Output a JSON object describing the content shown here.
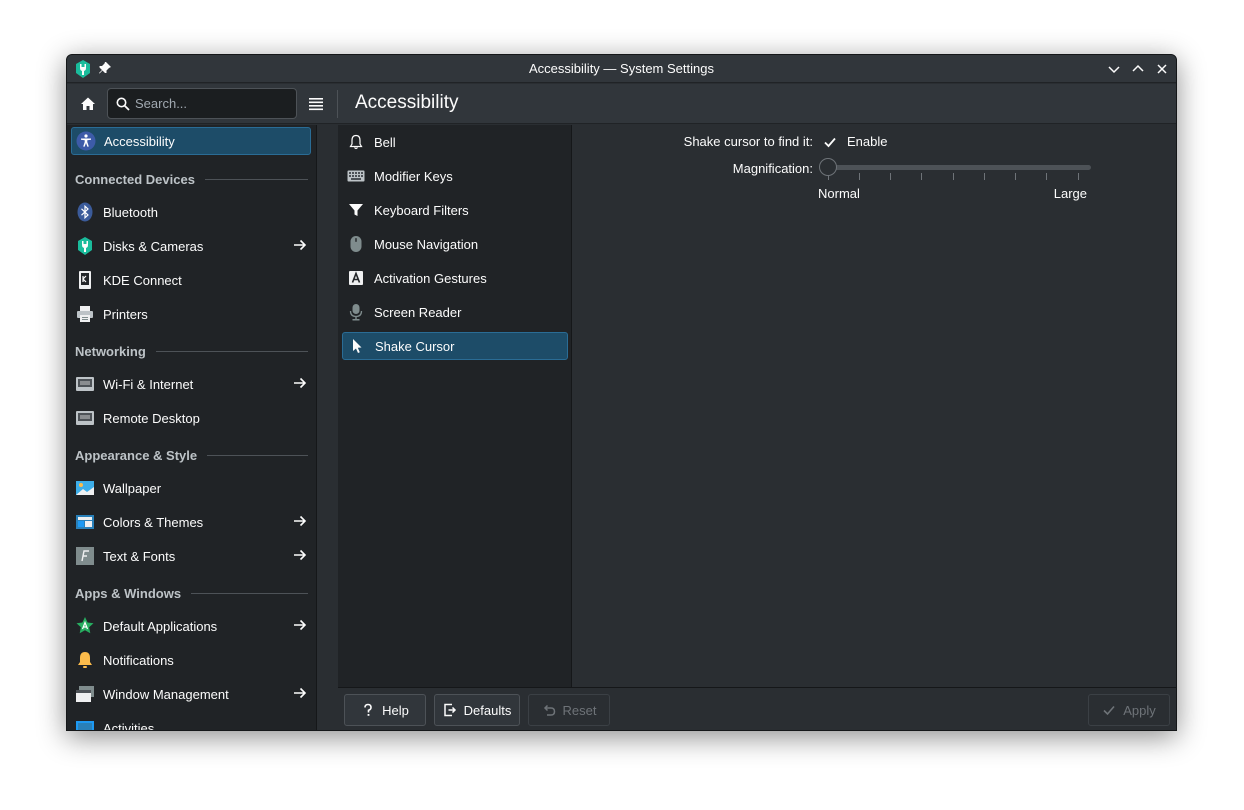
{
  "window": {
    "title": "Accessibility — System Settings"
  },
  "toolbar": {
    "search_placeholder": "Search...",
    "page_title": "Accessibility"
  },
  "sidebar": {
    "active": {
      "label": "Accessibility",
      "icon": "accessibility-icon"
    },
    "sections": [
      {
        "header": "Connected Devices",
        "items": [
          {
            "label": "Bluetooth",
            "icon": "bluetooth-icon",
            "arrow": false
          },
          {
            "label": "Disks & Cameras",
            "icon": "disks-icon",
            "arrow": true
          },
          {
            "label": "KDE Connect",
            "icon": "kde-connect-icon",
            "arrow": false
          },
          {
            "label": "Printers",
            "icon": "printer-icon",
            "arrow": false
          }
        ]
      },
      {
        "header": "Networking",
        "items": [
          {
            "label": "Wi-Fi & Internet",
            "icon": "network-icon",
            "arrow": true
          },
          {
            "label": "Remote Desktop",
            "icon": "remote-desktop-icon",
            "arrow": false
          }
        ]
      },
      {
        "header": "Appearance & Style",
        "items": [
          {
            "label": "Wallpaper",
            "icon": "wallpaper-icon",
            "arrow": false
          },
          {
            "label": "Colors & Themes",
            "icon": "colors-icon",
            "arrow": true
          },
          {
            "label": "Text & Fonts",
            "icon": "fonts-icon",
            "arrow": true
          }
        ]
      },
      {
        "header": "Apps & Windows",
        "items": [
          {
            "label": "Default Applications",
            "icon": "default-apps-icon",
            "arrow": true
          },
          {
            "label": "Notifications",
            "icon": "bell-yellow-icon",
            "arrow": false
          },
          {
            "label": "Window Management",
            "icon": "window-management-icon",
            "arrow": true
          },
          {
            "label": "Activities",
            "icon": "activities-icon",
            "arrow": false
          }
        ]
      }
    ]
  },
  "subpanel": {
    "items": [
      {
        "label": "Bell",
        "icon": "bell-icon"
      },
      {
        "label": "Modifier Keys",
        "icon": "keyboard-icon"
      },
      {
        "label": "Keyboard Filters",
        "icon": "filter-icon"
      },
      {
        "label": "Mouse Navigation",
        "icon": "mouse-icon"
      },
      {
        "label": "Activation Gestures",
        "icon": "gesture-icon"
      },
      {
        "label": "Screen Reader",
        "icon": "microphone-icon"
      },
      {
        "label": "Shake Cursor",
        "icon": "cursor-icon",
        "active": true
      }
    ]
  },
  "content": {
    "shake_label": "Shake cursor to find it:",
    "enable_label": "Enable",
    "enable_checked": true,
    "magnification_label": "Magnification:",
    "slider_min_label": "Normal",
    "slider_max_label": "Large",
    "slider_value": 0
  },
  "footer": {
    "help": "Help",
    "defaults": "Defaults",
    "reset": "Reset",
    "apply": "Apply"
  }
}
